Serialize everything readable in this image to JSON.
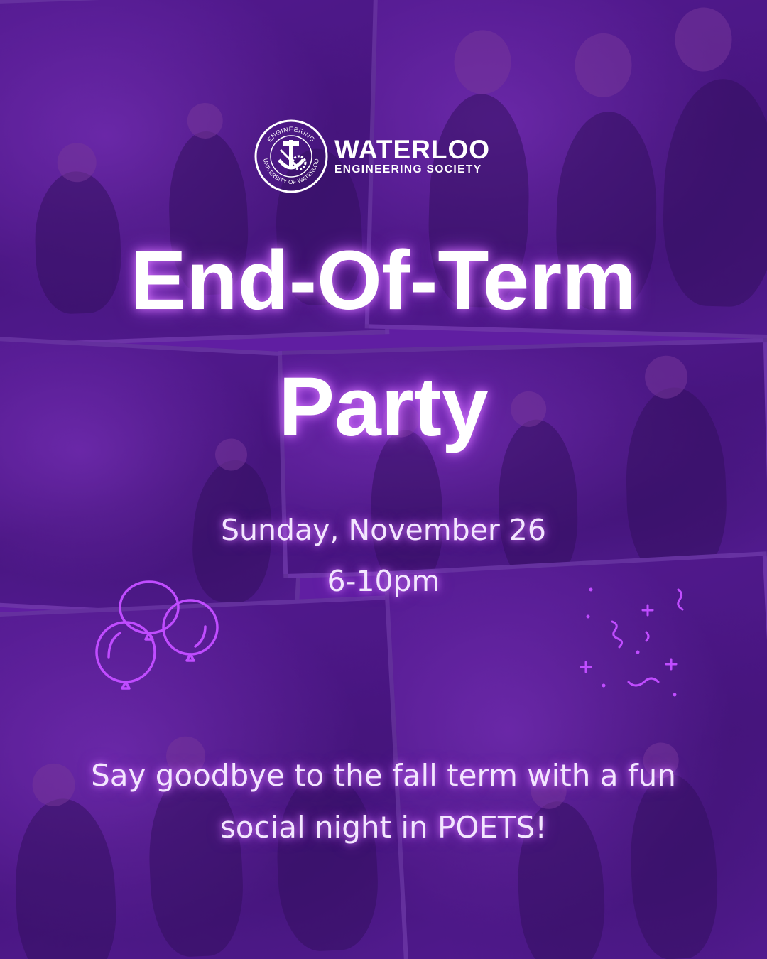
{
  "logo": {
    "seal_top_text": "ENGINEERING",
    "seal_bottom_text": "UNIVERSITY OF WATERLOO",
    "name": "WATERLOO",
    "subtitle": "ENGINEERING SOCIETY"
  },
  "title": {
    "line1": "End-Of-Term",
    "line2": "Party"
  },
  "event": {
    "date": "Sunday, November 26",
    "time": "6-10pm"
  },
  "description": {
    "line1": "Say goodbye to the fall term with a fun",
    "line2": "social night in POETS!"
  },
  "decorations": {
    "left_icon": "balloons-icon",
    "right_icon": "confetti-icon"
  },
  "colors": {
    "background": "#5b1b98",
    "accent_glow": "#c04cff",
    "text": "#ffffff"
  }
}
